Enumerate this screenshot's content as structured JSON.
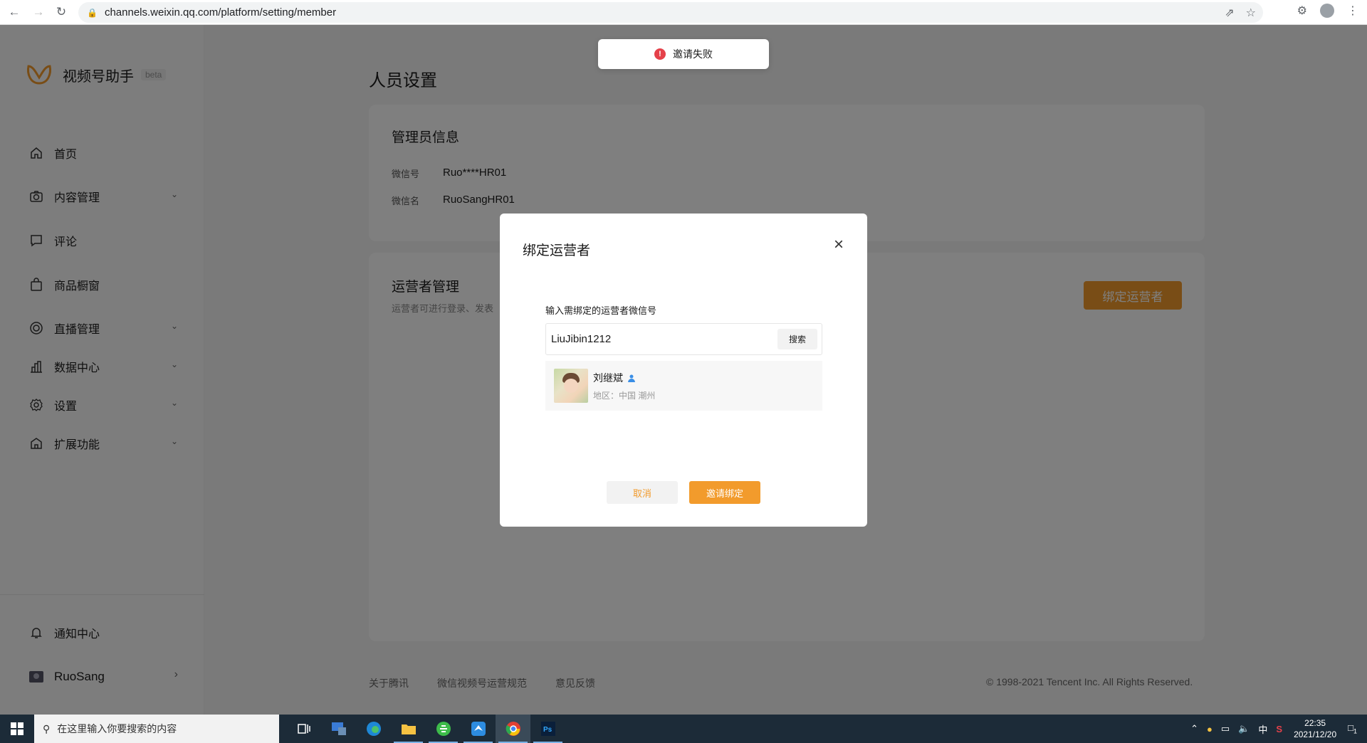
{
  "browser": {
    "url": "channels.weixin.qq.com/platform/setting/member"
  },
  "sidebar": {
    "brand": "视频号助手",
    "beta": "beta",
    "items": [
      {
        "label": "首页",
        "icon": "home-icon"
      },
      {
        "label": "内容管理",
        "icon": "camera-icon"
      },
      {
        "label": "评论",
        "icon": "comment-icon"
      },
      {
        "label": "商品橱窗",
        "icon": "shopping-bag-icon"
      },
      {
        "label": "直播管理",
        "icon": "live-icon"
      },
      {
        "label": "数据中心",
        "icon": "bar-chart-icon"
      },
      {
        "label": "设置",
        "icon": "gear-icon"
      },
      {
        "label": "扩展功能",
        "icon": "puzzle-icon"
      }
    ],
    "notification": "通知中心",
    "user": "RuoSang"
  },
  "main": {
    "title": "人员设置",
    "admin": {
      "title": "管理员信息",
      "wechat_id_label": "微信号",
      "wechat_id": "Ruo****HR01",
      "wechat_name_label": "微信名",
      "wechat_name": "RuoSangHR01"
    },
    "operators": {
      "title": "运营者管理",
      "desc": "运营者可进行登录、发表",
      "bind_button": "绑定运营者"
    },
    "footer": {
      "about": "关于腾讯",
      "rules": "微信视频号运营规范",
      "feedback": "意见反馈",
      "copyright": "© 1998-2021 Tencent Inc. All Rights Reserved."
    }
  },
  "toast": {
    "message": "邀请失败"
  },
  "modal": {
    "title": "绑定运营者",
    "label": "输入需绑定的运营者微信号",
    "search_value": "LiuJibin1212",
    "search_button": "搜索",
    "result": {
      "name": "刘继斌",
      "area": "地区：中国 潮州"
    },
    "cancel": "取消",
    "invite": "邀请绑定"
  },
  "taskbar": {
    "search_placeholder": "在这里输入你要搜索的内容",
    "ime": "中",
    "time": "22:35",
    "date": "2021/12/20",
    "notification_count": "1"
  },
  "colors": {
    "accent": "#f29b2c",
    "error": "#e5414a"
  }
}
